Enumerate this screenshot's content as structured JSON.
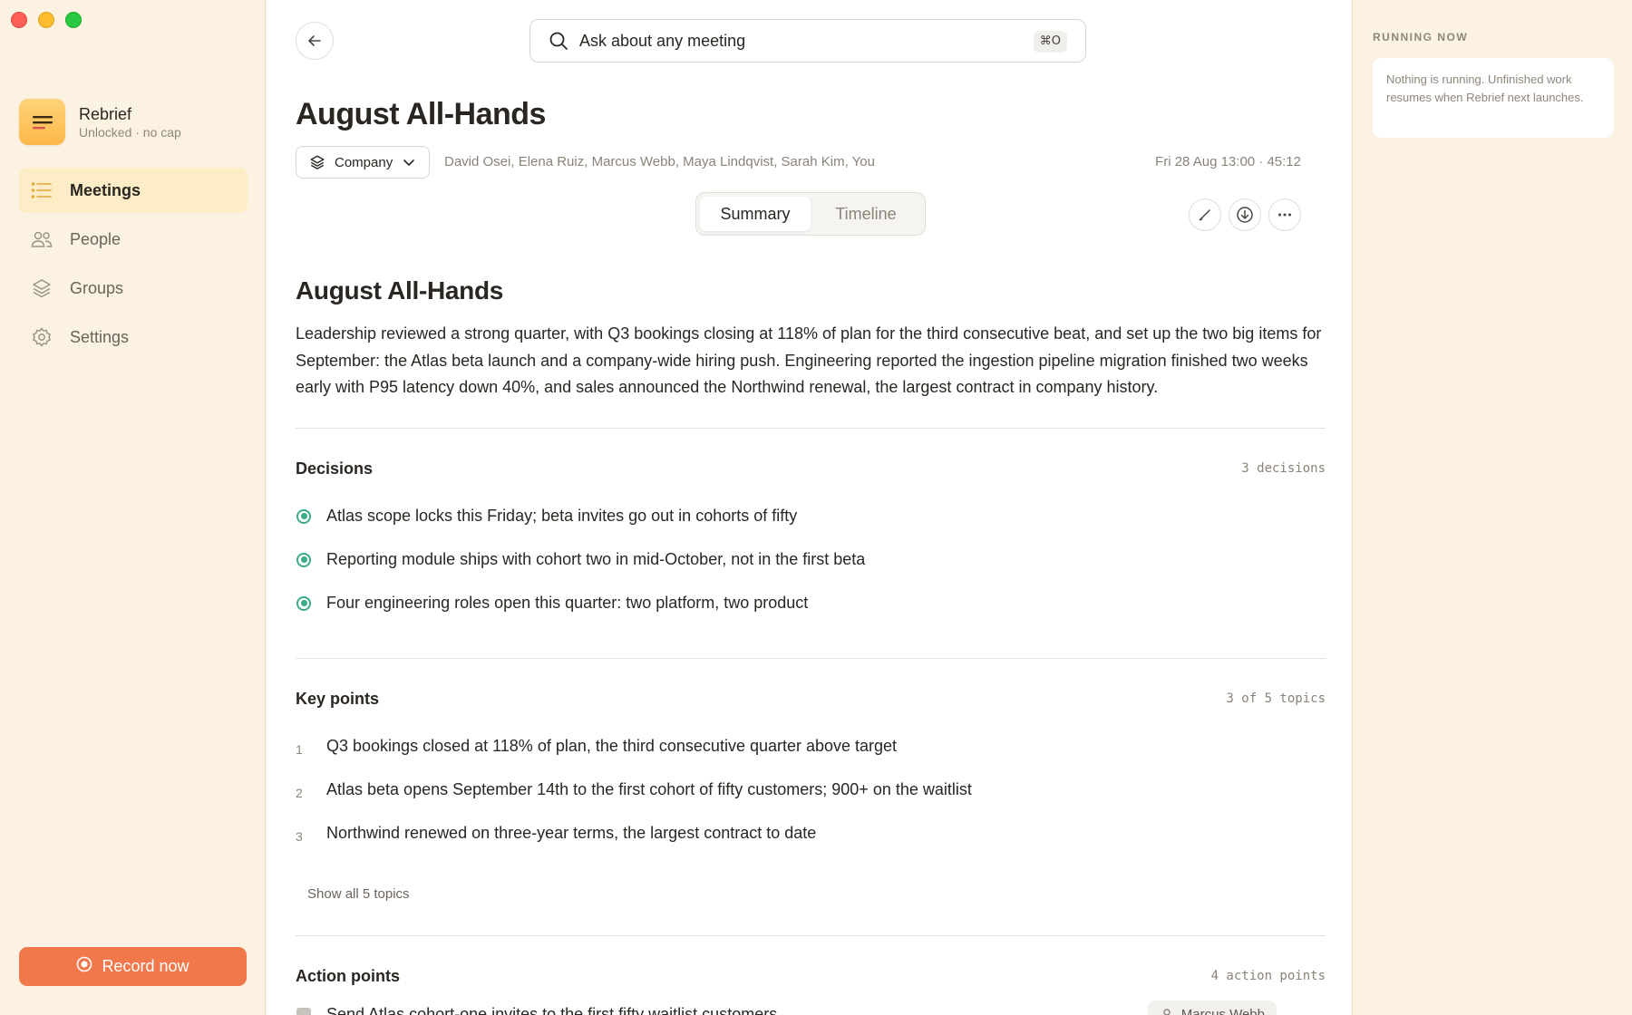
{
  "window": {
    "controls": [
      "close",
      "minimize",
      "maximize"
    ]
  },
  "sidebar": {
    "app_name": "Rebrief",
    "app_status": "Unlocked · no cap",
    "items": [
      {
        "label": "Meetings",
        "icon": "list-icon",
        "active": true
      },
      {
        "label": "People",
        "icon": "people-icon",
        "active": false
      },
      {
        "label": "Groups",
        "icon": "layers-icon",
        "active": false
      },
      {
        "label": "Settings",
        "icon": "gear-icon",
        "active": false
      }
    ],
    "record_label": "Record now"
  },
  "search": {
    "placeholder": "Ask about any meeting",
    "shortcut": "⌘O"
  },
  "meeting": {
    "title": "August All-Hands",
    "group": "Company",
    "attendees": "David Osei, Elena Ruiz, Marcus Webb, Maya Lindqvist, Sarah Kim, You",
    "datetime": "Fri 28 Aug 13:00 · 45:12"
  },
  "tabs": [
    {
      "label": "Summary",
      "active": true
    },
    {
      "label": "Timeline",
      "active": false
    }
  ],
  "summary": {
    "heading": "August All-Hands",
    "text": "Leadership reviewed a strong quarter, with Q3 bookings closing at 118% of plan for the third consecutive beat, and set up the two big items for September: the Atlas beta launch and a company-wide hiring push. Engineering reported the ingestion pipeline migration finished two weeks early with P95 latency down 40%, and sales announced the Northwind renewal, the largest contract in company history."
  },
  "decisions": {
    "title": "Decisions",
    "count": "3 decisions",
    "items": [
      "Atlas scope locks this Friday; beta invites go out in cohorts of fifty",
      "Reporting module ships with cohort two in mid-October, not in the first beta",
      "Four engineering roles open this quarter: two platform, two product"
    ]
  },
  "key_points": {
    "title": "Key points",
    "count": "3 of 5 topics",
    "items": [
      {
        "num": "1",
        "text": "Q3 bookings closed at 118% of plan, the third consecutive quarter above target"
      },
      {
        "num": "2",
        "text": "Atlas beta opens September 14th to the first cohort of fifty customers; 900+ on the waitlist"
      },
      {
        "num": "3",
        "text": "Northwind renewed on three-year terms, the largest contract to date"
      }
    ],
    "show_all": "Show all 5 topics"
  },
  "action_points": {
    "title": "Action points",
    "count": "4 action points",
    "items": [
      {
        "text": "Send Atlas cohort-one invites to the first fifty waitlist customers",
        "assignee": "Marcus Webb"
      }
    ]
  },
  "running_now": {
    "label": "RUNNING NOW",
    "message": "Nothing is running. Unfinished work resumes when Rebrief next launches."
  },
  "colors": {
    "accent": "#f1784b",
    "brand": "#fdb84a",
    "decision": "#3bab82",
    "sidebar_bg": "#fbf2e1"
  }
}
